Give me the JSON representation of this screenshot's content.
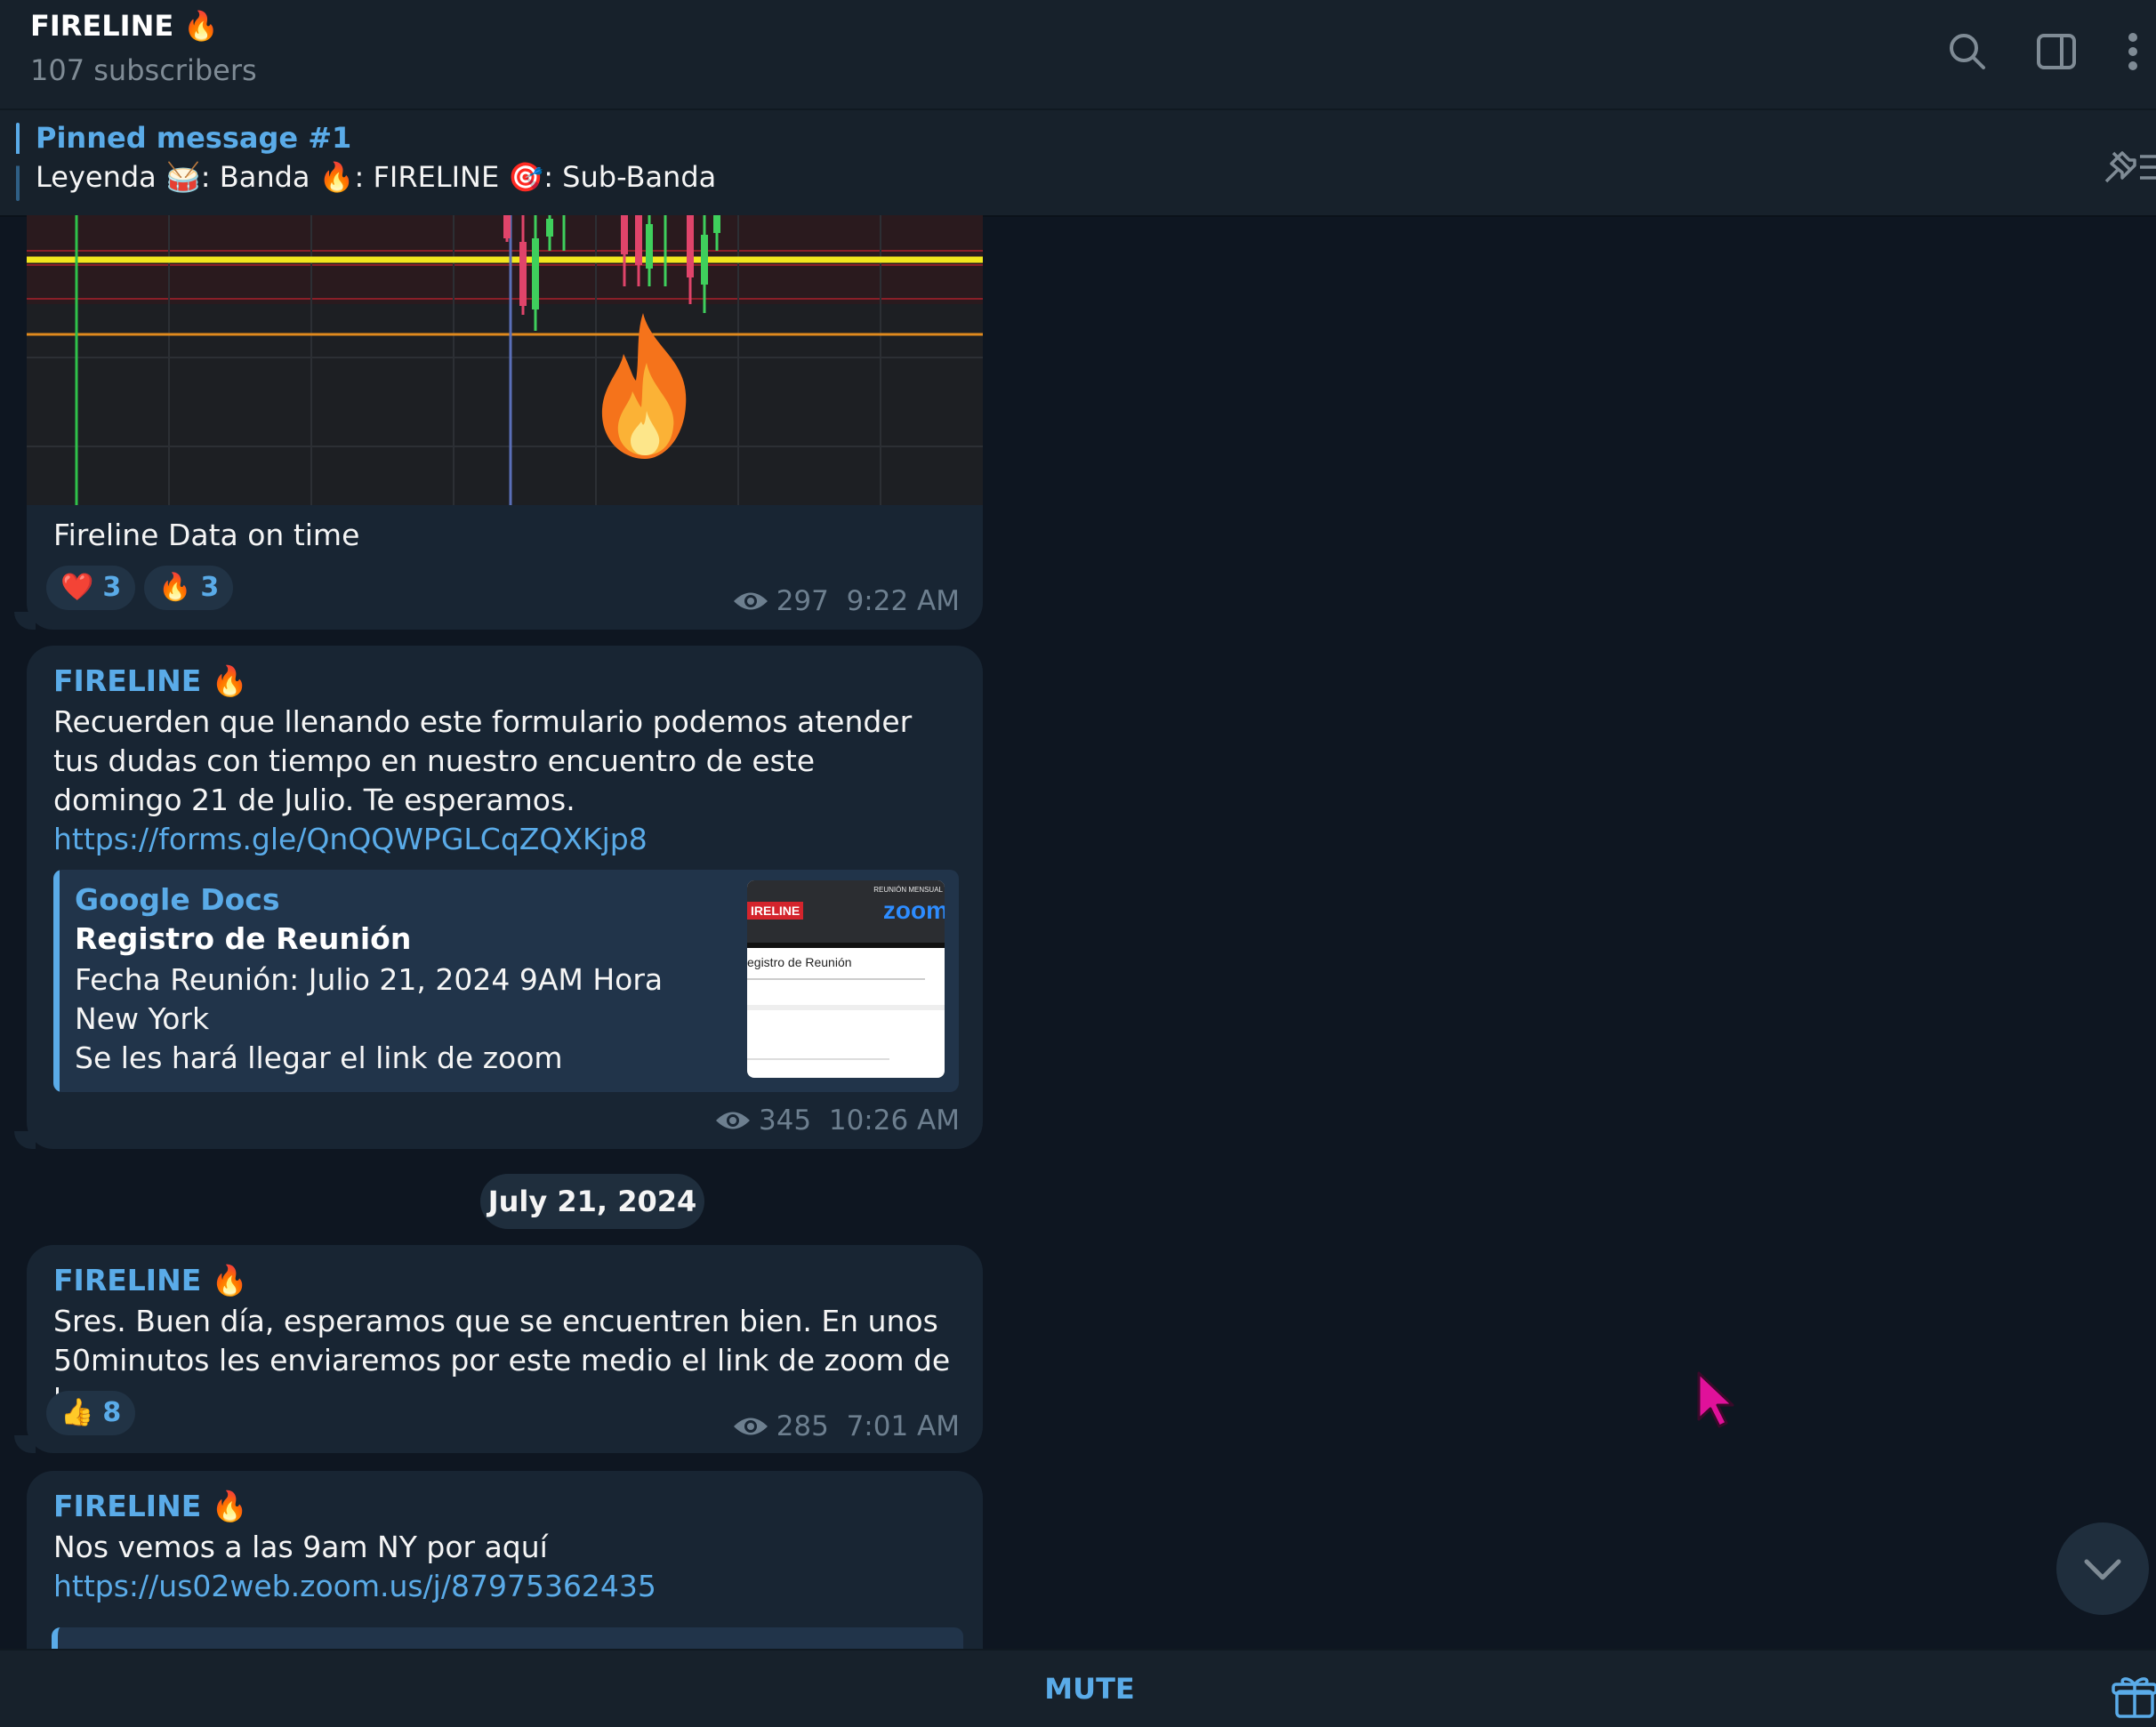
{
  "header": {
    "title": "FIRELINE 🔥",
    "subscribers": "107 subscribers",
    "icons": [
      "search-icon",
      "sidebar-toggle-icon",
      "more-vertical-icon"
    ]
  },
  "pinned": {
    "title": "Pinned message #1",
    "text": "Leyenda 🥁: Banda  🔥: FIRELINE  🎯: Sub-Banda"
  },
  "messages": [
    {
      "caption": "Fireline Data on time",
      "reactions": [
        {
          "emoji": "❤️",
          "count": "3"
        },
        {
          "emoji": "🔥",
          "count": "3"
        }
      ],
      "views": "297",
      "time": "9:22 AM"
    },
    {
      "sender": "FIRELINE 🔥",
      "text": "Recuerden que llenando este formulario podemos atender tus dudas con tiempo en nuestro encuentro de este domingo 21 de Julio. Te esperamos.",
      "link": "https://forms.gle/QnQQWPGLCqZQXKjp8",
      "preview": {
        "site": "Google Docs",
        "title": "Registro de Reunión",
        "desc_line1": "Fecha Reunión: Julio 21, 2024 9AM Hora New York",
        "desc_line2": "Se les hará llegar el link de zoom",
        "thumb_brand": "IRELINE",
        "thumb_zoom": "zoom",
        "thumb_banner": "REUNIÓN MENSUAL",
        "thumb_heading": "egistro de Reunión"
      },
      "views": "345",
      "time": "10:26 AM"
    },
    {
      "date": "July 21, 2024"
    },
    {
      "sender": "FIRELINE 🔥",
      "text": "Sres. Buen día, esperamos que se encuentren bien. En unos 50minutos les enviaremos por este medio el link de zoom de hoy.",
      "reactions": [
        {
          "emoji": "👍",
          "count": "8"
        }
      ],
      "views": "285",
      "time": "7:01 AM"
    },
    {
      "sender": "FIRELINE 🔥",
      "text": "Nos vemos a las 9am NY por aquí",
      "link": "https://us02web.zoom.us/j/87975362435"
    }
  ],
  "bottom": {
    "mute_label": "MUTE"
  },
  "colors": {
    "accent": "#5aabe8",
    "background": "#0e1621",
    "bubble": "#182533",
    "header": "#17212b"
  }
}
